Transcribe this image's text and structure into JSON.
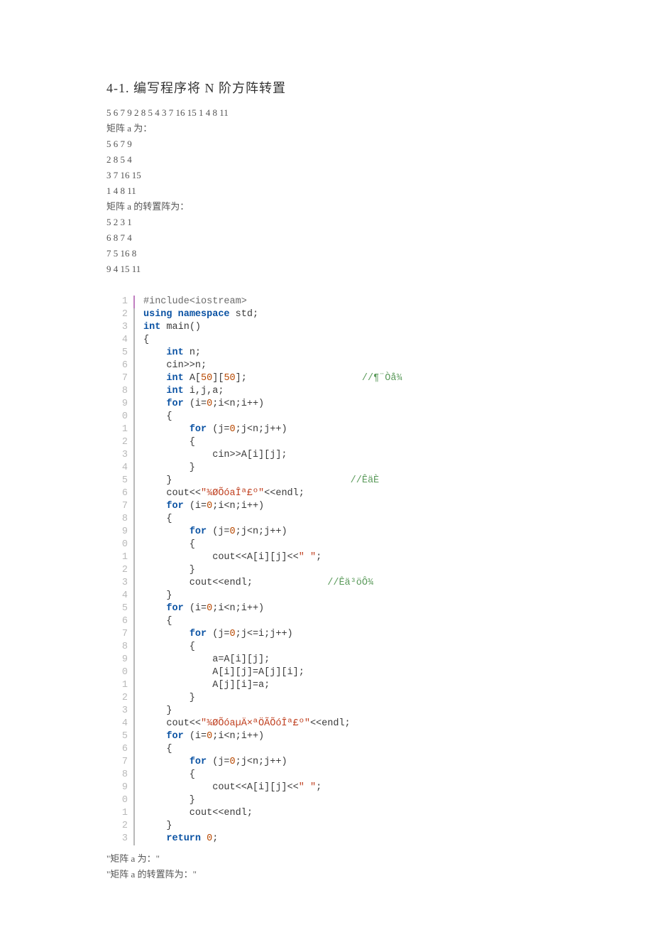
{
  "title": "4-1. 编写程序将 N 阶方阵转置",
  "intro_lines": [
    "5 6 7 9 2 8 5 4 3 7 16 15 1 4 8 11",
    "矩阵 a 为：",
    "5 6 7 9",
    "2 8 5 4",
    "3 7 16 15",
    "1 4 8 11",
    "矩阵 a 的转置阵为：",
    "5 2 3 1",
    "6 8 7 4",
    "7 5 16 8",
    "9 4 15 11"
  ],
  "code_lines": [
    {
      "n": "1",
      "html": "<span class='pp'>#include&lt;iostream&gt;</span>"
    },
    {
      "n": "2",
      "html": "<span class='kw'>using</span> <span class='kw'>namespace</span> <span class='std0'>std</span>;"
    },
    {
      "n": "3",
      "html": "<span class='type'>int</span> main()"
    },
    {
      "n": "4",
      "html": "{"
    },
    {
      "n": "5",
      "html": "    <span class='type'>int</span> n;"
    },
    {
      "n": "6",
      "html": "    cin&gt;&gt;n;"
    },
    {
      "n": "7",
      "html": "    <span class='type'>int</span> A[<span class='num'>50</span>][<span class='num'>50</span>];                    <span class='cmt'>//¶¨Òå¾</span>"
    },
    {
      "n": "8",
      "html": "    <span class='type'>int</span> i,j,a;"
    },
    {
      "n": "9",
      "html": "    <span class='kw'>for</span> (i=<span class='num'>0</span>;i&lt;n;i++)"
    },
    {
      "n": "0",
      "html": "    {"
    },
    {
      "n": "1",
      "html": "        <span class='kw'>for</span> (j=<span class='num'>0</span>;j&lt;n;j++)"
    },
    {
      "n": "2",
      "html": "        {"
    },
    {
      "n": "3",
      "html": "            cin&gt;&gt;A[i][j];"
    },
    {
      "n": "4",
      "html": "        }"
    },
    {
      "n": "5",
      "html": "    }                               <span class='cmt'>//ÊäÈ</span>"
    },
    {
      "n": "6",
      "html": "    cout&lt;&lt;<span class='str'>\"¾ØÕóaÎª£º\"</span>&lt;&lt;endl;"
    },
    {
      "n": "7",
      "html": "    <span class='kw'>for</span> (i=<span class='num'>0</span>;i&lt;n;i++)"
    },
    {
      "n": "8",
      "html": "    {"
    },
    {
      "n": "9",
      "html": "        <span class='kw'>for</span> (j=<span class='num'>0</span>;j&lt;n;j++)"
    },
    {
      "n": "0",
      "html": "        {"
    },
    {
      "n": "1",
      "html": "            cout&lt;&lt;A[i][j]&lt;&lt;<span class='str'>\" \"</span>;"
    },
    {
      "n": "2",
      "html": "        }"
    },
    {
      "n": "3",
      "html": "        cout&lt;&lt;endl;             <span class='cmt'>//Êä³öÔ­¾</span>"
    },
    {
      "n": "4",
      "html": "    }"
    },
    {
      "n": "5",
      "html": "    <span class='kw'>for</span> (i=<span class='num'>0</span>;i&lt;n;i++)"
    },
    {
      "n": "6",
      "html": "    {"
    },
    {
      "n": "7",
      "html": "        <span class='kw'>for</span> (j=<span class='num'>0</span>;j&lt;=i;j++)"
    },
    {
      "n": "8",
      "html": "        {"
    },
    {
      "n": "9",
      "html": "            a=A[i][j];"
    },
    {
      "n": "0",
      "html": "            A[i][j]=A[j][i];"
    },
    {
      "n": "1",
      "html": "            A[j][i]=a;"
    },
    {
      "n": "2",
      "html": "        }"
    },
    {
      "n": "3",
      "html": "    }"
    },
    {
      "n": "4",
      "html": "    cout&lt;&lt;<span class='str'>\"¾ØÕóaµÄ×ªÖÃÕóÎª£º\"</span>&lt;&lt;endl;"
    },
    {
      "n": "5",
      "html": "    <span class='kw'>for</span> (i=<span class='num'>0</span>;i&lt;n;i++)"
    },
    {
      "n": "6",
      "html": "    {"
    },
    {
      "n": "7",
      "html": "        <span class='kw'>for</span> (j=<span class='num'>0</span>;j&lt;n;j++)"
    },
    {
      "n": "8",
      "html": "        {"
    },
    {
      "n": "9",
      "html": "            cout&lt;&lt;A[i][j]&lt;&lt;<span class='str'>\" \"</span>;"
    },
    {
      "n": "0",
      "html": "        }"
    },
    {
      "n": "1",
      "html": "        cout&lt;&lt;endl;"
    },
    {
      "n": "2",
      "html": "    }"
    },
    {
      "n": "3",
      "html": "    <span class='kw'>return</span> <span class='num'>0</span>;"
    }
  ],
  "footer_lines": [
    "\"矩阵 a 为：\"",
    "\"矩阵 a 的转置阵为：\""
  ]
}
